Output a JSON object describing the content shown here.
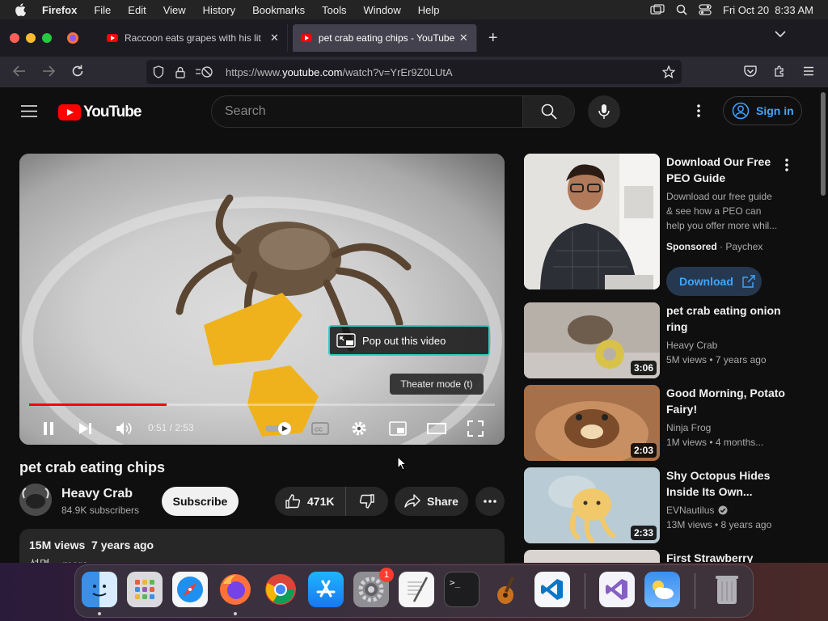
{
  "menubar": {
    "app": "Firefox",
    "items": [
      "File",
      "Edit",
      "View",
      "History",
      "Bookmarks",
      "Tools",
      "Window",
      "Help"
    ],
    "datetime": "Fri Oct 20  8:33 AM"
  },
  "tabs": [
    {
      "title": "Raccoon eats grapes with his lit",
      "active": false
    },
    {
      "title": "pet crab eating chips - YouTube",
      "active": true
    }
  ],
  "urlbar": {
    "prefix": "https://www.",
    "domain": "youtube.com",
    "path": "/watch?v=YrEr9Z0LUtA"
  },
  "youtube": {
    "logo_text": "YouTube",
    "search_placeholder": "Search",
    "signin_label": "Sign in"
  },
  "player": {
    "popout_label": "Pop out this video",
    "theater_tooltip": "Theater mode (t)",
    "time": "0:51 / 2:53",
    "progress": 0.295
  },
  "video": {
    "title": "pet crab eating chips",
    "channel": "Heavy Crab",
    "subscribers": "84.9K subscribers",
    "subscribe_label": "Subscribe",
    "likes": "471K",
    "share_label": "Share",
    "views_line": "15M views  7 years ago",
    "description_preview": "설명 ...more"
  },
  "sidebar": {
    "ad": {
      "title": "Download Our Free PEO Guide",
      "description": "Download our free guide & see how a PEO can help you offer more whil...",
      "sponsored": "Sponsored",
      "advertiser": "Paychex",
      "cta": "Download"
    },
    "videos": [
      {
        "title": "pet crab eating onion ring",
        "channel": "Heavy Crab",
        "meta": "5M views • 7 years ago",
        "duration": "3:06"
      },
      {
        "title": "Good Morning, Potato Fairy!",
        "channel": "Ninja Frog",
        "meta": "1M views • 4 months...",
        "duration": "2:03"
      },
      {
        "title": "Shy Octopus Hides Inside Its Own...",
        "channel": "EVNautilus",
        "meta": "13M views • 8 years ago",
        "duration": "2:33"
      },
      {
        "title": "First Strawberry",
        "channel": "",
        "meta": "",
        "duration": ""
      }
    ]
  },
  "dock": {
    "settings_badge": "1",
    "apps": [
      "finder-icon",
      "launchpad-icon",
      "safari-icon",
      "firefox-icon",
      "chrome-icon",
      "app-store-icon",
      "system-settings-icon",
      "textedit-icon",
      "terminal-icon",
      "garageband-icon",
      "vscode-icon",
      "visual-studio-icon",
      "weather-icon",
      "trash-icon"
    ]
  },
  "colors": {
    "youtube_red": "#ff0000",
    "link_blue": "#3ea6ff",
    "page_bg": "#0f0f0f"
  }
}
